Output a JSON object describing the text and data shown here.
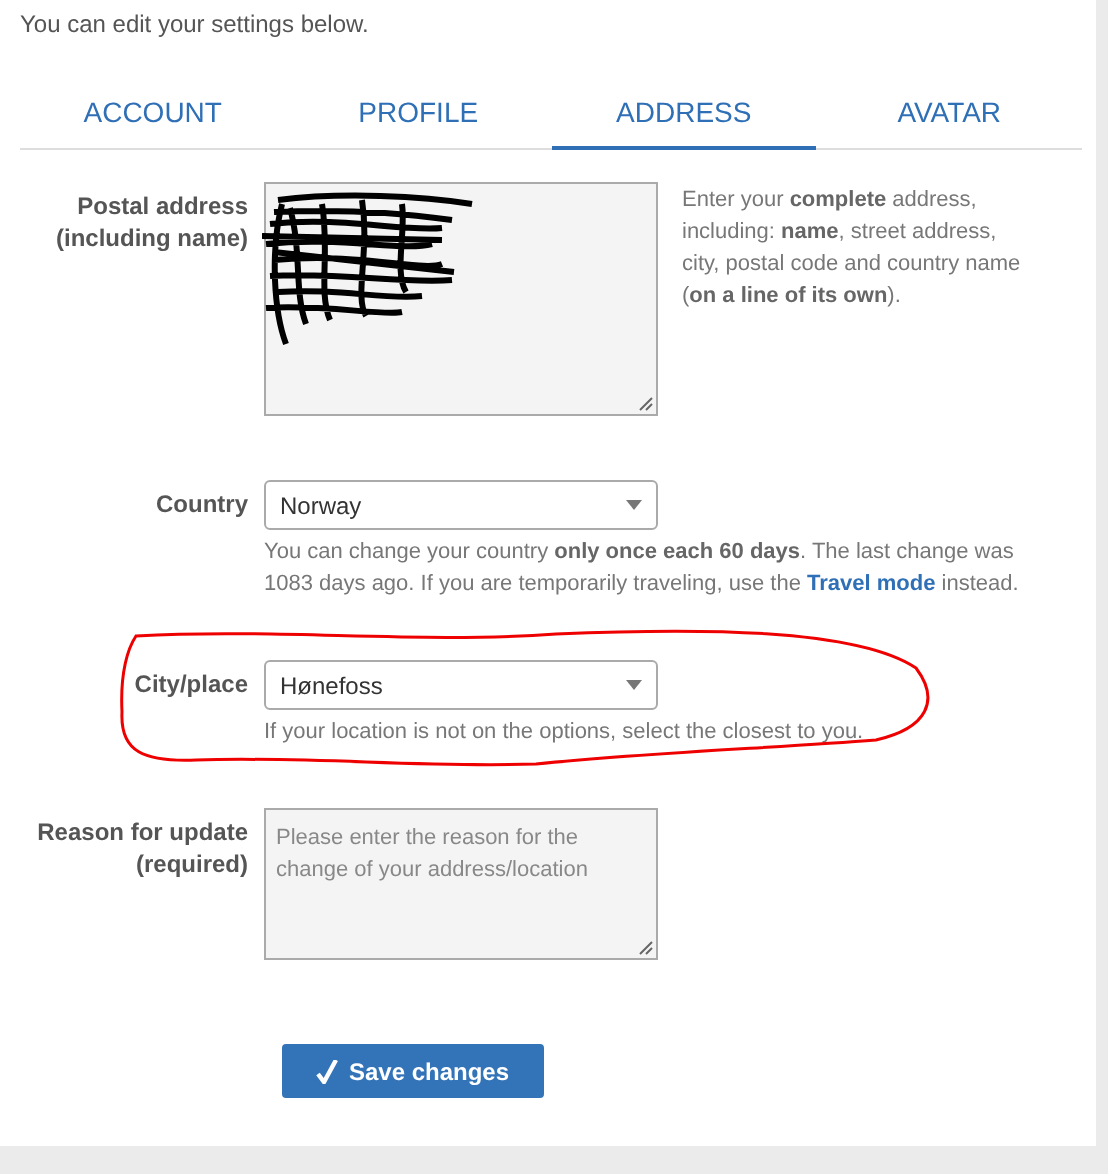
{
  "intro": "You can edit your settings below.",
  "tabs": [
    {
      "label": "ACCOUNT",
      "selected": false
    },
    {
      "label": "PROFILE",
      "selected": false
    },
    {
      "label": "ADDRESS",
      "selected": true
    },
    {
      "label": "AVATAR",
      "selected": false
    }
  ],
  "fields": [
    {
      "kind": "textarea",
      "label": "Postal address (including name)",
      "redacted": true,
      "help": "Enter your **complete** address, including: **name**, street address, city, postal code and country name (**on a line of its own**).",
      "help_side": true,
      "circled": false
    },
    {
      "kind": "select",
      "label": "Country",
      "value": "Norway",
      "help": "You can change your country **only once each 60 days**. The last change was 1083 days ago. If you are temporarily traveling, use the",
      "link": "Travel mode",
      "help_after": "instead.",
      "circled": false,
      "help_side": false
    },
    {
      "kind": "select",
      "label": "City/place",
      "value": "Hønefoss",
      "help": "If your location is not on the options, select the closest to you.",
      "circled": true,
      "help_side": false
    },
    {
      "kind": "textarea",
      "label": "Reason for update (required)",
      "placeholder": "Please enter the reason for the change of your address/location",
      "redacted": false,
      "circled": false
    }
  ],
  "save_button": "Save changes"
}
